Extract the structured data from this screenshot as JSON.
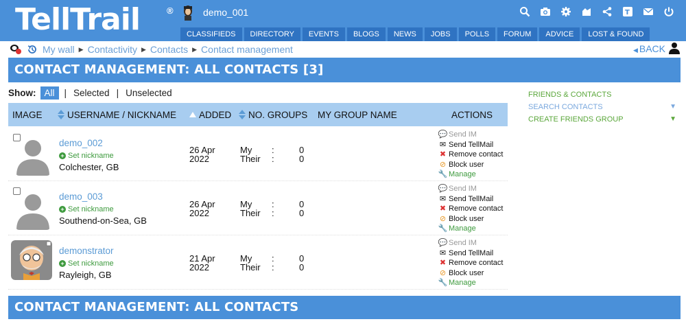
{
  "header": {
    "logo": "TellTrail",
    "reg_mark": "®",
    "username": "demo_001",
    "icons": [
      "search-icon",
      "camera-icon",
      "gear-icon",
      "friends-icon",
      "share-icon",
      "translate-icon",
      "mail-icon",
      "power-icon"
    ],
    "nav": [
      "CLASSIFIEDS",
      "DIRECTORY",
      "EVENTS",
      "BLOGS",
      "NEWS",
      "JOBS",
      "POLLS",
      "FORUM",
      "ADVICE",
      "LOST & FOUND"
    ]
  },
  "breadcrumb": {
    "items": [
      "My wall",
      "Contactivity",
      "Contacts",
      "Contact management"
    ],
    "back": "BACK"
  },
  "page": {
    "title": "CONTACT MANAGEMENT: ALL CONTACTS [3]",
    "footer_title": "CONTACT MANAGEMENT: ALL CONTACTS"
  },
  "filter": {
    "label": "Show:",
    "options": [
      "All",
      "Selected",
      "Unselected"
    ],
    "separator": "|"
  },
  "table": {
    "columns": [
      "IMAGE",
      "USERNAME / NICKNAME",
      "ADDED",
      "NO. GROUPS",
      "MY GROUP NAME",
      "ACTIONS"
    ],
    "set_nickname": "Set nickname",
    "group_labels": [
      "My",
      "Their"
    ],
    "group_colon": ":",
    "actions": [
      "Send IM",
      "Send TellMail",
      "Remove contact",
      "Block user",
      "Manage"
    ],
    "rows": [
      {
        "username": "demo_002",
        "location": "Colchester, GB",
        "added_day": "26 Apr",
        "added_year": "2022",
        "my_groups": "0",
        "their_groups": "0",
        "avatar": "silhouette"
      },
      {
        "username": "demo_003",
        "location": "Southend-on-Sea, GB",
        "added_day": "26 Apr",
        "added_year": "2022",
        "my_groups": "0",
        "their_groups": "0",
        "avatar": "silhouette"
      },
      {
        "username": "demonstrator",
        "location": "Rayleigh, GB",
        "added_day": "21 Apr",
        "added_year": "2022",
        "my_groups": "0",
        "their_groups": "0",
        "avatar": "cartoon"
      }
    ]
  },
  "sidebar": {
    "items": [
      "FRIENDS & CONTACTS",
      "SEARCH CONTACTS",
      "CREATE FRIENDS GROUP"
    ],
    "colors": {
      "green": "#5ba73b",
      "blue": "#7aa8de"
    }
  },
  "colors": {
    "brand": "#4a90d9",
    "nav": "#2f73c2",
    "table_header": "#a8cdf0",
    "link": "#5b9bd5"
  }
}
